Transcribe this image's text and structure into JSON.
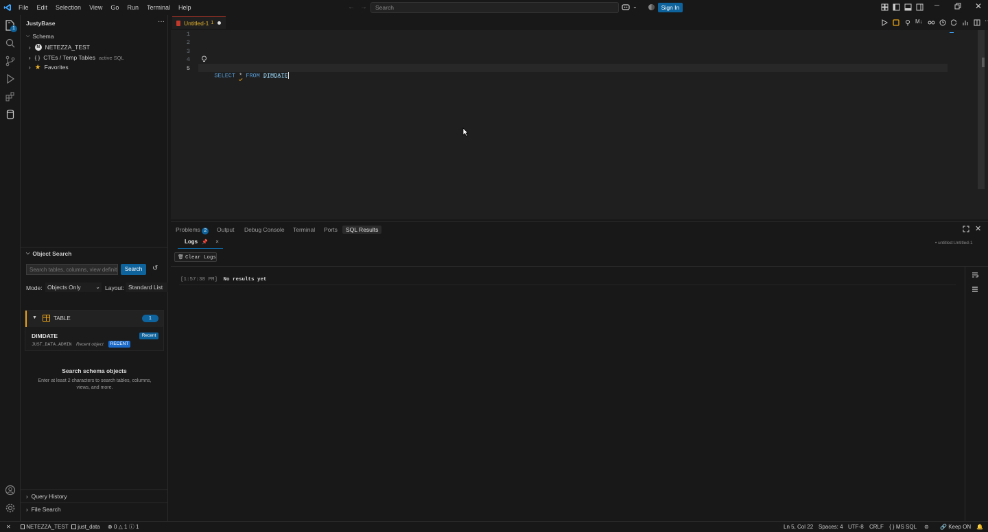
{
  "menu": [
    "File",
    "Edit",
    "Selection",
    "View",
    "Go",
    "Run",
    "Terminal",
    "Help"
  ],
  "titlebar": {
    "search_placeholder": "Search",
    "signin_label": "Sign In"
  },
  "activity": {
    "explorer_badge": "1"
  },
  "sidebar": {
    "title": "JustyBase",
    "schema_label": "Schema",
    "items": [
      {
        "label": "NETEZZA_TEST",
        "icon": "n-badge-icon"
      },
      {
        "label": "CTEs / Temp Tables",
        "tag": "active SQL",
        "icon": "braces-icon"
      },
      {
        "label": "Favorites",
        "icon": "star-icon"
      }
    ],
    "object_search": {
      "title": "Object Search",
      "placeholder": "Search tables, columns, view definitions...",
      "search_button": "Search",
      "mode_label": "Mode:",
      "mode_value": "Objects Only",
      "layout_label": "Layout:",
      "layout_value": "Standard List"
    },
    "group": {
      "name": "TABLE",
      "count": "1"
    },
    "result": {
      "name": "DIMDATE",
      "path": "JUST_DATA.ADMIN",
      "meta": "Recent object",
      "badge_recent": "Recent",
      "badge_upper": "RECENT"
    },
    "hint": {
      "title": "Search schema objects",
      "text": "Enter at least 2 characters to search tables, columns, views, and more."
    },
    "bottom": [
      "Query History",
      "File Search"
    ]
  },
  "editor": {
    "tab": "Untitled-1",
    "tab_badge": "1",
    "lines": [
      "1",
      "2",
      "3",
      "4",
      "5"
    ],
    "code": {
      "kw1": "SELECT",
      "star": "*",
      "kw2": "FROM",
      "ident": "DIMDATE"
    }
  },
  "panel": {
    "tabs": [
      "Problems",
      "Output",
      "Debug Console",
      "Terminal",
      "Ports",
      "SQL Results"
    ],
    "problems_count": "2",
    "subtab": "Logs",
    "right_label": "• untitled:Untitled-1",
    "clear_button": "Clear Logs",
    "log_time": "[1:57:38 PM]",
    "log_text": "No results yet"
  },
  "status": {
    "connection": "NETEZZA_TEST",
    "database": "just_data",
    "errors": "0",
    "warnings": "1",
    "info": "1",
    "position": "Ln 5, Col 22",
    "spaces": "Spaces: 4",
    "encoding": "UTF-8",
    "eol": "CRLF",
    "language": "MS SQL",
    "keep": "Keep ON"
  },
  "colors": {
    "accent": "#0e639c",
    "keyword": "#569cd6",
    "tab_modified": "#e1b12c",
    "table_group": "#e8a317"
  }
}
